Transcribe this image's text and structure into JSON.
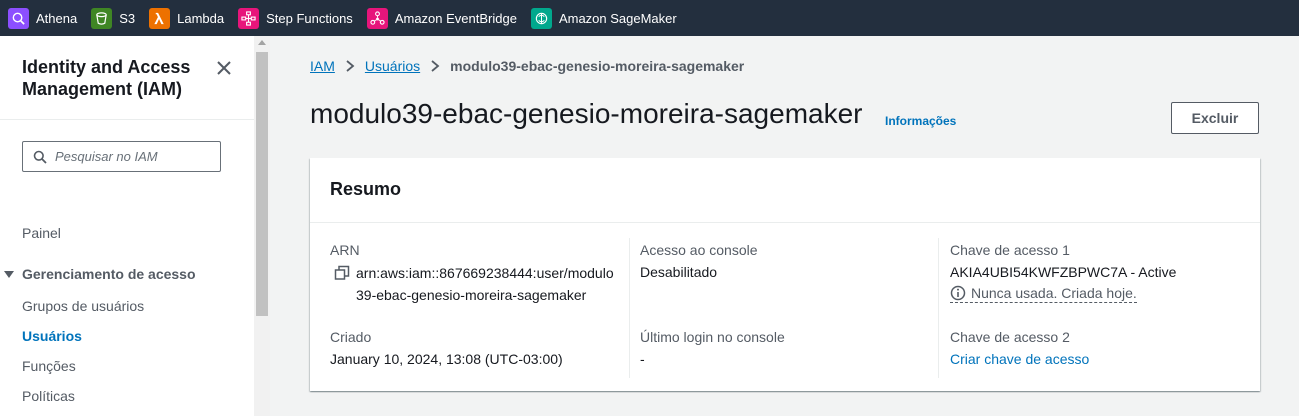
{
  "top_services": [
    {
      "label": "Athena",
      "icon": "athena-icon",
      "color": "#8c4fff"
    },
    {
      "label": "S3",
      "icon": "s3-icon",
      "color": "#3f8624"
    },
    {
      "label": "Lambda",
      "icon": "lambda-icon",
      "color": "#ed7100"
    },
    {
      "label": "Step Functions",
      "icon": "step-functions-icon",
      "color": "#e7157b"
    },
    {
      "label": "Amazon EventBridge",
      "icon": "eventbridge-icon",
      "color": "#e7157b"
    },
    {
      "label": "Amazon SageMaker",
      "icon": "sagemaker-icon",
      "color": "#01a88d"
    }
  ],
  "sidebar": {
    "title": "Identity and Access Management (IAM)",
    "search_placeholder": "Pesquisar no IAM",
    "items": [
      {
        "label": "Painel"
      },
      {
        "label": "Gerenciamento de acesso"
      },
      {
        "label": "Grupos de usuários"
      },
      {
        "label": "Usuários"
      },
      {
        "label": "Funções"
      },
      {
        "label": "Políticas"
      }
    ]
  },
  "breadcrumb": {
    "items": [
      "IAM",
      "Usuários",
      "modulo39-ebac-genesio-moreira-sagemaker"
    ]
  },
  "header": {
    "title": "modulo39-ebac-genesio-moreira-sagemaker",
    "info_label": "Informações",
    "delete_label": "Excluir"
  },
  "summary": {
    "title": "Resumo",
    "arn_label": "ARN",
    "arn_value": "arn:aws:iam::867669238444:user/modulo39-ebac-genesio-moreira-sagemaker",
    "created_label": "Criado",
    "created_value": "January 10, 2024, 13:08 (UTC-03:00)",
    "console_access_label": "Acesso ao console",
    "console_access_value": "Desabilitado",
    "last_login_label": "Último login no console",
    "last_login_value": "-",
    "access_key1_label": "Chave de acesso 1",
    "access_key1_value": "AKIA4UBI54KWFZBPWC7A - Active",
    "access_key1_note": "Nunca usada. Criada hoje.",
    "access_key2_label": "Chave de acesso 2",
    "access_key2_action": "Criar chave de acesso"
  },
  "colors": {
    "topbar": "#232f3e",
    "link": "#0073bb",
    "text": "#16191f",
    "muted": "#545b64",
    "page_bg": "#f2f3f3"
  }
}
